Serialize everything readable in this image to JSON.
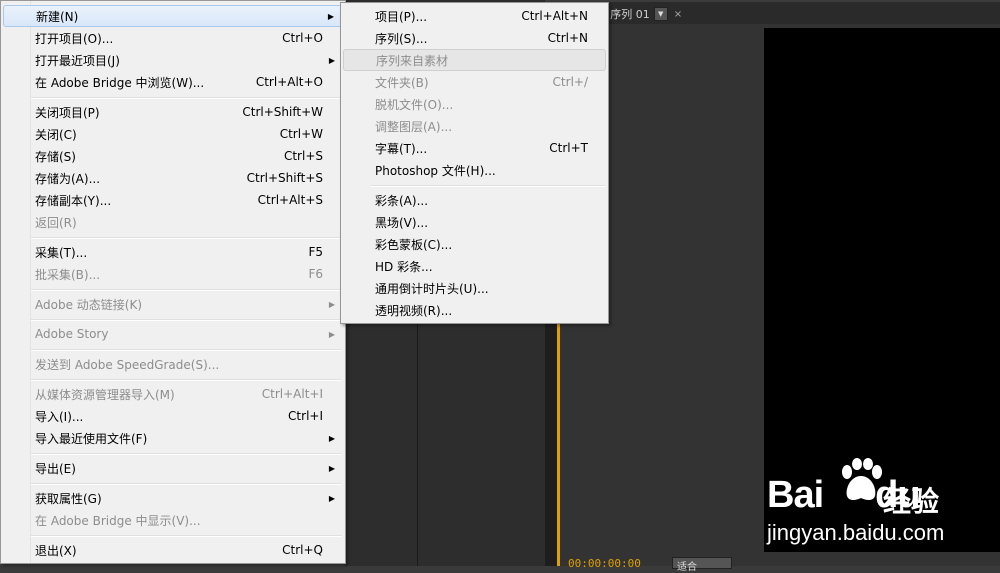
{
  "background": {
    "tab_label": ": 序列 01",
    "tab_close": "×",
    "timecode": "00:00:00:00",
    "fit_label": "适合"
  },
  "file_menu": {
    "items": [
      {
        "label": "新建(N)",
        "shortcut": "",
        "submenu": true,
        "disabled": false
      },
      {
        "label": "打开项目(O)...",
        "shortcut": "Ctrl+O",
        "submenu": false,
        "disabled": false
      },
      {
        "label": "打开最近项目(J)",
        "shortcut": "",
        "submenu": true,
        "disabled": false
      },
      {
        "label": "在 Adobe Bridge 中浏览(W)...",
        "shortcut": "Ctrl+Alt+O",
        "submenu": false,
        "disabled": false
      },
      {
        "label": "关闭项目(P)",
        "shortcut": "Ctrl+Shift+W",
        "submenu": false,
        "disabled": false
      },
      {
        "label": "关闭(C)",
        "shortcut": "Ctrl+W",
        "submenu": false,
        "disabled": false
      },
      {
        "label": "存储(S)",
        "shortcut": "Ctrl+S",
        "submenu": false,
        "disabled": false
      },
      {
        "label": "存储为(A)...",
        "shortcut": "Ctrl+Shift+S",
        "submenu": false,
        "disabled": false
      },
      {
        "label": "存储副本(Y)...",
        "shortcut": "Ctrl+Alt+S",
        "submenu": false,
        "disabled": false
      },
      {
        "label": "返回(R)",
        "shortcut": "",
        "submenu": false,
        "disabled": true
      },
      {
        "label": "采集(T)...",
        "shortcut": "F5",
        "submenu": false,
        "disabled": false
      },
      {
        "label": "批采集(B)...",
        "shortcut": "F6",
        "submenu": false,
        "disabled": true
      },
      {
        "label": "Adobe 动态链接(K)",
        "shortcut": "",
        "submenu": true,
        "disabled": true
      },
      {
        "label": "Adobe Story",
        "shortcut": "",
        "submenu": true,
        "disabled": true
      },
      {
        "label": "发送到 Adobe SpeedGrade(S)...",
        "shortcut": "",
        "submenu": false,
        "disabled": true
      },
      {
        "label": "从媒体资源管理器导入(M)",
        "shortcut": "Ctrl+Alt+I",
        "submenu": false,
        "disabled": true
      },
      {
        "label": "导入(I)...",
        "shortcut": "Ctrl+I",
        "submenu": false,
        "disabled": false
      },
      {
        "label": "导入最近使用文件(F)",
        "shortcut": "",
        "submenu": true,
        "disabled": false
      },
      {
        "label": "导出(E)",
        "shortcut": "",
        "submenu": true,
        "disabled": false
      },
      {
        "label": "获取属性(G)",
        "shortcut": "",
        "submenu": true,
        "disabled": false
      },
      {
        "label": "在 Adobe Bridge 中显示(V)...",
        "shortcut": "",
        "submenu": false,
        "disabled": true
      },
      {
        "label": "退出(X)",
        "shortcut": "Ctrl+Q",
        "submenu": false,
        "disabled": false
      }
    ]
  },
  "new_submenu": {
    "items": [
      {
        "label": "项目(P)...",
        "shortcut": "Ctrl+Alt+N",
        "disabled": false
      },
      {
        "label": "序列(S)...",
        "shortcut": "Ctrl+N",
        "disabled": false
      },
      {
        "label": "序列来自素材",
        "shortcut": "",
        "disabled": true
      },
      {
        "label": "文件夹(B)",
        "shortcut": "Ctrl+/",
        "disabled": true
      },
      {
        "label": "脱机文件(O)...",
        "shortcut": "",
        "disabled": true
      },
      {
        "label": "调整图层(A)...",
        "shortcut": "",
        "disabled": true
      },
      {
        "label": "字幕(T)...",
        "shortcut": "Ctrl+T",
        "disabled": false
      },
      {
        "label": "Photoshop 文件(H)...",
        "shortcut": "",
        "disabled": false
      },
      {
        "label": "彩条(A)...",
        "shortcut": "",
        "disabled": false
      },
      {
        "label": "黑场(V)...",
        "shortcut": "",
        "disabled": false
      },
      {
        "label": "彩色蒙板(C)...",
        "shortcut": "",
        "disabled": false
      },
      {
        "label": "HD 彩条...",
        "shortcut": "",
        "disabled": false
      },
      {
        "label": "通用倒计时片头(U)...",
        "shortcut": "",
        "disabled": false
      },
      {
        "label": "透明视频(R)...",
        "shortcut": "",
        "disabled": false
      }
    ]
  },
  "watermark": {
    "brand_latin": "Bai",
    "brand_mid": "du",
    "brand_cn": "经验",
    "url": "jingyan.baidu.com"
  },
  "colors": {
    "menu_bg": "#f0f0f0",
    "highlight": "#d8e7f8",
    "disabled_text": "#8d8d8d",
    "timecode": "#e0a000"
  }
}
